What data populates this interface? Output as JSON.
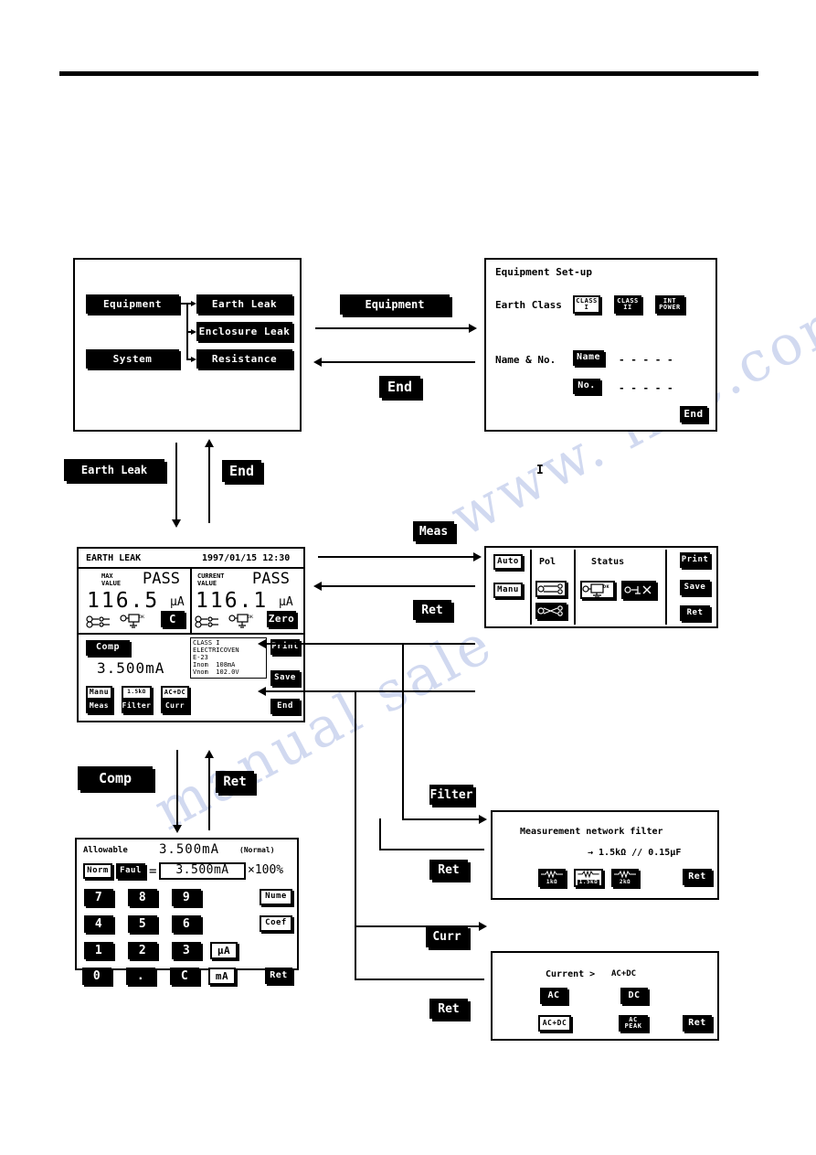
{
  "menu_screen": {
    "buttons": [
      {
        "label": "Equipment",
        "state": "normal"
      },
      {
        "label": "System",
        "state": "normal"
      },
      {
        "label": "Earth Leak",
        "state": "normal"
      },
      {
        "label": "Enclosure Leak",
        "state": "normal"
      },
      {
        "label": "Resistance",
        "state": "normal"
      }
    ]
  },
  "equipment_setup": {
    "title": "Equipment Set-up",
    "earth_class_label": "Earth Class",
    "class_buttons": [
      {
        "label": "CLASS\nI",
        "state": "selected"
      },
      {
        "label": "CLASS\nII",
        "state": "normal"
      },
      {
        "label": "INT\nPOWER",
        "state": "normal"
      }
    ],
    "name_no_label": "Name & No.",
    "name_button": "Name",
    "name_value": "- - - - -",
    "no_button": "No.",
    "no_value": "- - - - -",
    "end_button": "End"
  },
  "nav": {
    "equipment": "Equipment",
    "end_1": "End",
    "earth_leak": "Earth Leak",
    "end_2": "End",
    "meas": "Meas",
    "ret_1": "Ret",
    "comp": "Comp",
    "ret_2": "Ret",
    "filter": "Filter",
    "ret_3": "Ret",
    "curr": "Curr",
    "ret_4": "Ret",
    "marker_i": "I"
  },
  "earth_leak_screen": {
    "title": "EARTH LEAK",
    "datetime": "1997/01/15 12:30",
    "max": {
      "label": "MAX\nVALUE",
      "verdict": "PASS",
      "value": "116.5",
      "unit": "μA",
      "action_button": "C"
    },
    "current": {
      "label": "CURRENT\nVALUE",
      "verdict": "PASS",
      "value": "116.1",
      "unit": "μA",
      "action_button": "Zero"
    },
    "comp_button": "Comp",
    "comp_value": "3.500mA",
    "info_lines": [
      "CLASS I",
      "ELECTRICOVEN",
      "E-23",
      "Inom  108mA",
      "Vnom  102.0V"
    ],
    "left_keys": [
      {
        "top": "Manu",
        "bottom": "Meas"
      },
      {
        "top": "1.5kΩ",
        "bottom": "Filter"
      },
      {
        "top": "AC+DC",
        "bottom": "Curr"
      }
    ],
    "right_keys": [
      "Print",
      "Save",
      "End"
    ]
  },
  "status_screen": {
    "mode_auto": "Auto",
    "mode_manu": "Manu",
    "pol_label": "Pol",
    "status_label": "Status",
    "right_keys": [
      "Print",
      "Save",
      "Ret"
    ]
  },
  "comp_screen": {
    "allowable_label": "Allowable",
    "allowable_value": "3.500mA",
    "allowable_mode": "(Normal)",
    "norm_button": "Norm",
    "faul_button": "Faul",
    "equals": "=",
    "entry_value": "3.500mA",
    "multiply": "×100%",
    "keypad": [
      [
        "7",
        "8",
        "9"
      ],
      [
        "4",
        "5",
        "6"
      ],
      [
        "1",
        "2",
        "3"
      ],
      [
        "0",
        ".",
        "C"
      ]
    ],
    "unit_uA": "μA",
    "unit_mA": "mA",
    "nume_button": "Nume",
    "coef_button": "Coef",
    "ret_button": "Ret"
  },
  "filter_screen": {
    "title": "Measurement network filter",
    "value": "→ 1.5kΩ // 0.15μF",
    "options": [
      {
        "label": "1kΩ",
        "state": "normal"
      },
      {
        "label": "1.5kΩ",
        "state": "selected"
      },
      {
        "label": "2kΩ",
        "state": "normal"
      }
    ],
    "ret_button": "Ret"
  },
  "current_screen": {
    "title": "Current >",
    "title_value": "AC+DC",
    "options": [
      {
        "label": "AC",
        "state": "normal"
      },
      {
        "label": "DC",
        "state": "normal"
      },
      {
        "label": "AC+DC",
        "state": "selected"
      },
      {
        "label": "AC\nPEAK",
        "state": "normal"
      }
    ],
    "ret_button": "Ret"
  }
}
